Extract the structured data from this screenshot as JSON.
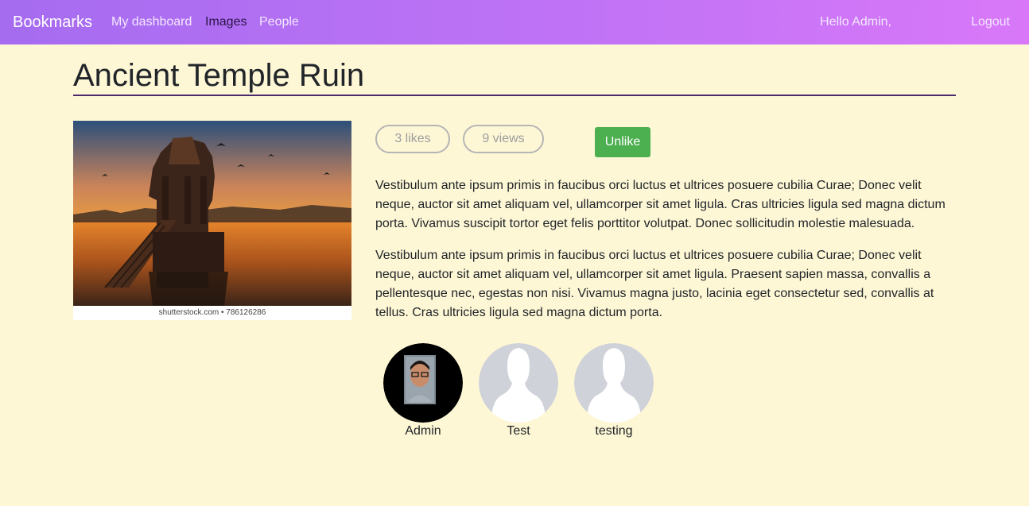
{
  "nav": {
    "brand": "Bookmarks",
    "links": [
      "My dashboard",
      "Images",
      "People"
    ],
    "active": "Images",
    "greeting": "Hello Admin,",
    "logout": "Logout"
  },
  "image": {
    "title": "Ancient Temple Ruin",
    "watermark": "shutterstock.com • 786126286",
    "likes": "3 likes",
    "views": "9 views",
    "like_button": "Unlike",
    "paragraphs": [
      "Vestibulum ante ipsum primis in faucibus orci luctus et ultrices posuere cubilia Curae; Donec velit neque, auctor sit amet aliquam vel, ullamcorper sit amet ligula. Cras ultricies ligula sed magna dictum porta. Vivamus suscipit tortor eget felis porttitor volutpat. Donec sollicitudin molestie malesuada.",
      "Vestibulum ante ipsum primis in faucibus orci luctus et ultrices posuere cubilia Curae; Donec velit neque, auctor sit amet aliquam vel, ullamcorper sit amet ligula. Praesent sapien massa, convallis a pellentesque nec, egestas non nisi. Vivamus magna justo, lacinia eget consectetur sed, convallis at tellus. Cras ultricies ligula sed magna dictum porta."
    ]
  },
  "likers": [
    {
      "name": "Admin",
      "avatar": "photo-avatar"
    },
    {
      "name": "Test",
      "avatar": "default-avatar"
    },
    {
      "name": "testing",
      "avatar": "default-avatar"
    }
  ],
  "colors": {
    "background": "#fef7d6",
    "nav_start": "#a56cf0",
    "nav_end": "#d878f8",
    "unlike": "#4caf50"
  }
}
